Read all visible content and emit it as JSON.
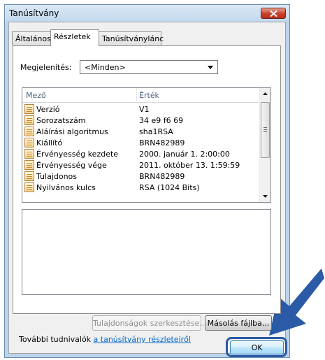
{
  "window": {
    "title": "Tanúsítvány",
    "close_icon": "close-icon"
  },
  "tabs": [
    {
      "label": "Általános",
      "active": false
    },
    {
      "label": "Részletek",
      "active": true
    },
    {
      "label": "Tanúsítványlánc",
      "active": false
    }
  ],
  "show": {
    "label": "Megjelenítés:",
    "selected": "<Minden>"
  },
  "list": {
    "columns": [
      "Mező",
      "Érték"
    ],
    "rows": [
      {
        "field": "Verzió",
        "value": "V1"
      },
      {
        "field": "Sorozatszám",
        "value": "34 e9 f6 69"
      },
      {
        "field": "Aláírási algoritmus",
        "value": "sha1RSA"
      },
      {
        "field": "Kiállító",
        "value": "BRN482989"
      },
      {
        "field": "Érvényesség kezdete",
        "value": "2000. január 1. 2:00:00"
      },
      {
        "field": "Érvényesség vége",
        "value": "2011. október 13. 1:59:59"
      },
      {
        "field": "Tulajdonos",
        "value": "BRN482989"
      },
      {
        "field": "Nyilvános kulcs",
        "value": "RSA (1024 Bits)"
      }
    ]
  },
  "buttons": {
    "edit_properties": "Tulajdonságok szerkesztése...",
    "copy_to_file": "Másolás fájlba...",
    "ok": "OK"
  },
  "info": {
    "prefix": "További tudnivalók ",
    "link": "a tanúsítvány részleteiről"
  },
  "colors": {
    "accent": "#2b5aa6",
    "link": "#0066cc"
  }
}
